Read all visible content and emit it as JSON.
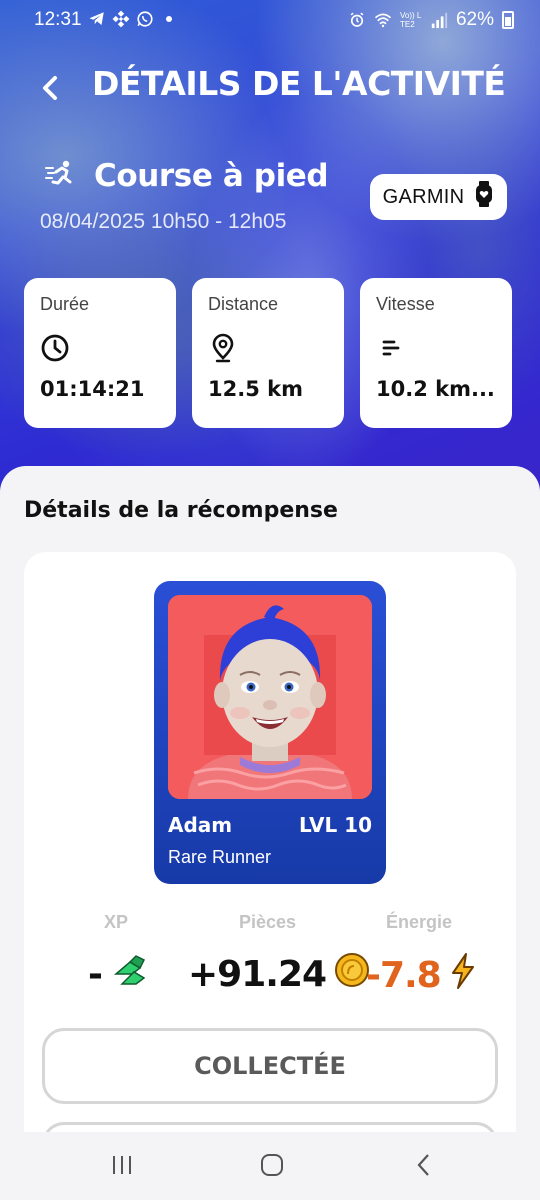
{
  "status_bar": {
    "time": "12:31",
    "left_icons": [
      "telegram-icon",
      "binance-icon",
      "whatsapp-icon",
      "dot-icon"
    ],
    "right_icons": [
      "alarm-icon",
      "wifi-icon",
      "volte-icon",
      "signal-icon"
    ],
    "volte_text": "Vo)) LTE2",
    "battery": "62%"
  },
  "header": {
    "title": "DÉTAILS DE L'ACTIVITÉ",
    "back_icon": "chevron-left-icon"
  },
  "activity": {
    "type": "Course à pied",
    "icon": "running-icon",
    "datetime": "08/04/2025 10h50 - 12h05",
    "source": "GARMIN",
    "source_icon": "watch-heart-icon"
  },
  "stats": [
    {
      "label": "Durée",
      "icon": "clock-icon",
      "value": "01:14:21"
    },
    {
      "label": "Distance",
      "icon": "location-pin-icon",
      "value": "12.5 km"
    },
    {
      "label": "Vitesse",
      "icon": "speed-lines-icon",
      "value": "10.2 km..."
    }
  ],
  "reward": {
    "section_title": "Détails de la récompense",
    "card": {
      "name": "Adam",
      "level": "LVL 10",
      "rarity": "Rare Runner"
    },
    "labels": {
      "xp": "XP",
      "coins": "Pièces",
      "energy": "Énergie"
    },
    "values": {
      "xp": "-",
      "coins": "+91.24",
      "energy": "-7.8"
    },
    "colors": {
      "energy": "#e0641e",
      "coin": "#f5b81c",
      "xp": "#2fcf6f"
    },
    "button_label": "COLLECTÉE"
  },
  "nav": {
    "recent_icon": "recent-apps-icon",
    "home_icon": "home-icon",
    "back_icon": "back-icon"
  }
}
